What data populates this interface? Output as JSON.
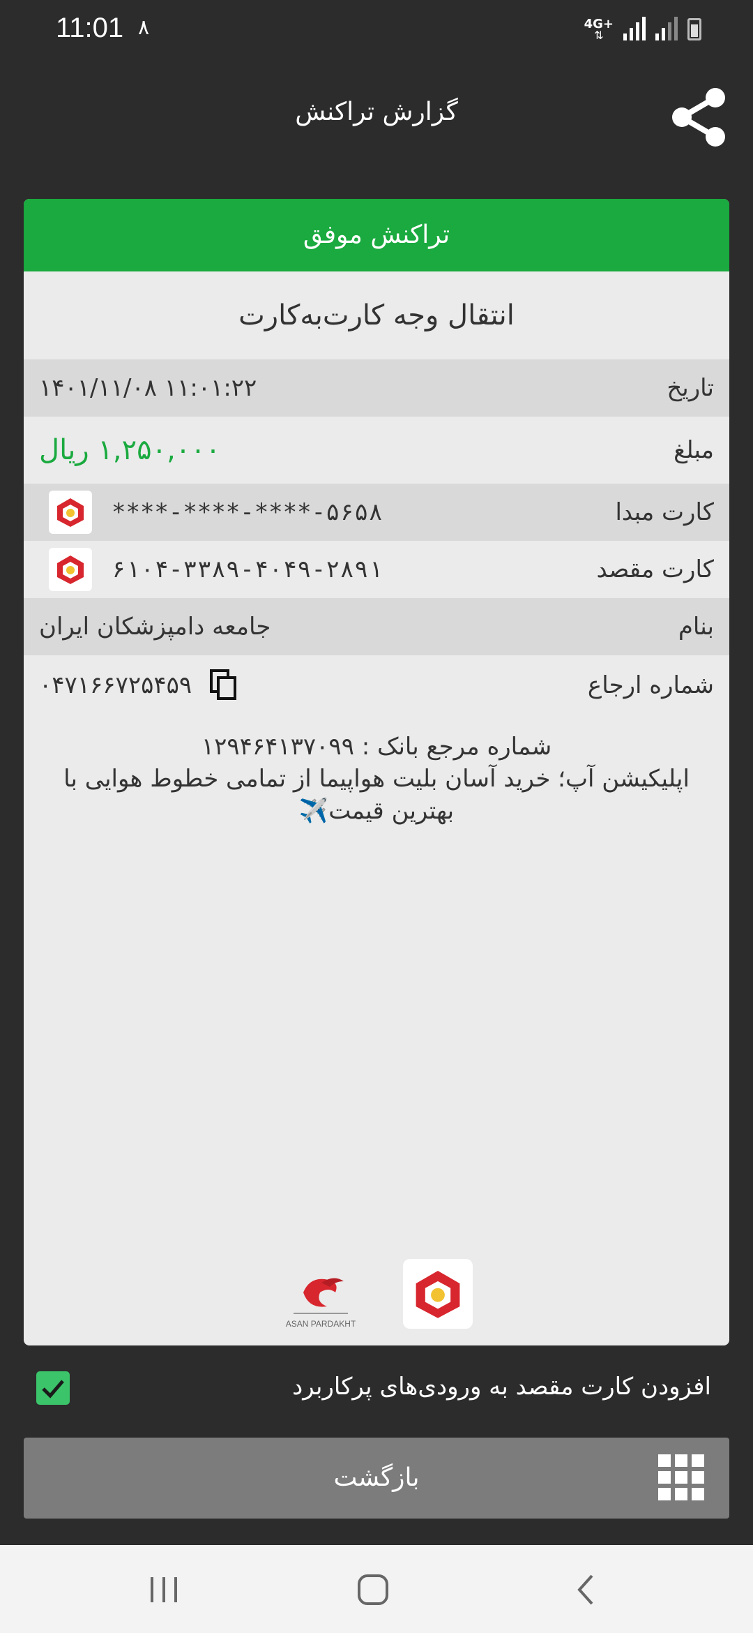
{
  "status_bar": {
    "time": "11:01",
    "extra": "٨",
    "network": "4G+"
  },
  "header": {
    "title": "گزارش تراکنش"
  },
  "card": {
    "status": "تراکنش موفق",
    "status_color": "#1aaa3f",
    "type": "انتقال وجه کارت‌به‌کارت",
    "rows": {
      "date": {
        "label": "تاریخ",
        "value": "۱۴۰۱/۱۱/۰۸ ۱۱:۰۱:۲۲"
      },
      "amount": {
        "label": "مبلغ",
        "value": "۱,۲۵۰,۰۰۰ ریال"
      },
      "source_card": {
        "label": "کارت مبدا",
        "value": "****-****-****-۵۶۵۸"
      },
      "dest_card": {
        "label": "کارت مقصد",
        "value": "۶۱۰۴-۳۳۸۹-۴۰۴۹-۲۸۹۱"
      },
      "name": {
        "label": "بنام",
        "value": "جامعه دامپزشکان ایران"
      },
      "reference": {
        "label": "شماره ارجاع",
        "value": "۰۴۷۱۶۶۷۲۵۴۵۹"
      }
    },
    "bank_reference": "شماره مرجع بانک : ۱۲۹۴۶۴۱۳۷۰۹۹",
    "promo": "اپلیکیشن آپ؛ خرید آسان بلیت هواپیما از تمامی خطوط هوایی با بهترین قیمت✈️",
    "asan_logo_text": "ASAN PARDAKHT"
  },
  "checkbox": {
    "label": "افزودن کارت مقصد به ورودی‌های پرکاربرد",
    "checked": true
  },
  "back_button": {
    "label": "بازگشت"
  }
}
